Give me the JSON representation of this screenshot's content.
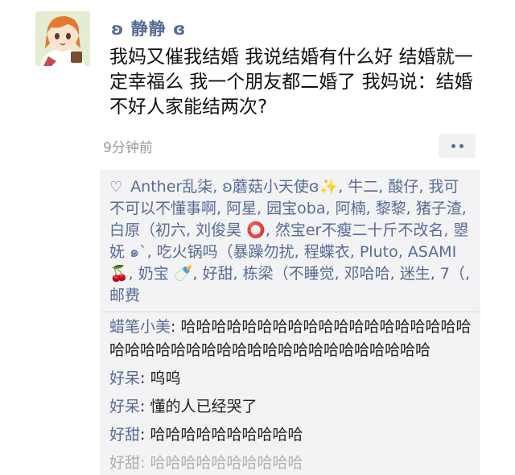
{
  "post": {
    "username": "ʚ 静静 ɞ",
    "text": "我妈又催我结婚 我说结婚有什么好 结婚就一定幸福么 我一个朋友都二婚了 我妈说：结婚不好人家能结两次?",
    "timestamp": "9分钟前"
  },
  "likes": {
    "icon": "heart-outline-icon",
    "text": "Anther乱柒, ʚ蘑菇小天使ɞ✨, 牛二, 酸仔, 我可不可以不懂事啊, 阿星, 园宝oba, 阿楠, 黎黎, 猪子渣, 白原（初六, 刘俊昊 ⭕, 然宝er不瘦二十斤不改名, 曌妩 ๑`, 吃火锅吗（暴躁勿扰, 程蝶衣, Pluto, ASAMI 🍒, 奶宝 🍼, 好甜, 栋梁（不睡觉, 邓哈哈, 迷生, 7（, 邮费"
  },
  "comments": [
    {
      "author": "蜡笔小美",
      "text": "哈哈哈哈哈哈哈哈哈哈哈哈哈哈哈哈哈哈哈哈哈哈哈哈哈哈哈哈哈哈哈哈哈哈哈哈哈哈哈哈"
    },
    {
      "author": "好呆",
      "text": "呜呜"
    },
    {
      "author": "好呆",
      "text": "懂的人已经哭了"
    },
    {
      "author": "好甜",
      "text": "哈哈哈哈哈哈哈哈哈哈"
    },
    {
      "author": "好甜",
      "text": "哈哈哈哈哈哈哈哈哈哈"
    }
  ],
  "colors": {
    "link": "#576b95",
    "feedback_bg": "#f3f3f5"
  }
}
